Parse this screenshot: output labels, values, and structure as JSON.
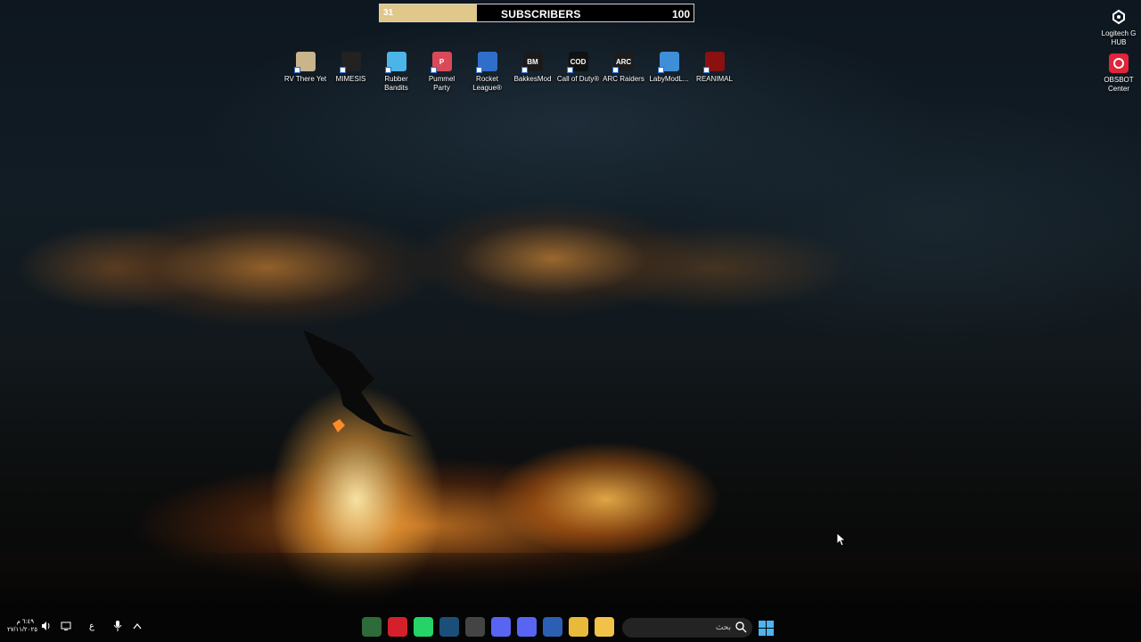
{
  "subscriber_widget": {
    "current": "31",
    "label": "SUBSCRIBERS",
    "goal": "100",
    "progress_fraction": 0.31,
    "fill_color": "#e0c78a"
  },
  "desktop_icons": [
    {
      "label": "RV There Yet",
      "icon": "rv-there-yet-icon",
      "color": "#c9b48c",
      "glyph": ""
    },
    {
      "label": "MIMESIS",
      "icon": "mimesis-icon",
      "color": "#222222",
      "glyph": ""
    },
    {
      "label": "Rubber Bandits",
      "icon": "rubber-bandits-icon",
      "color": "#4bb5e8",
      "glyph": ""
    },
    {
      "label": "Pummel Party",
      "icon": "pummel-party-icon",
      "color": "#d84a5a",
      "glyph": "P"
    },
    {
      "label": "Rocket League®",
      "icon": "rocket-league-icon",
      "color": "#2f6fc9",
      "glyph": ""
    },
    {
      "label": "BakkesMod",
      "icon": "bakkesmod-icon",
      "color": "#1a1a1a",
      "glyph": "BM"
    },
    {
      "label": "Call of Duty®",
      "icon": "call-of-duty-icon",
      "color": "#111111",
      "glyph": "COD"
    },
    {
      "label": "ARC Raiders",
      "icon": "arc-raiders-icon",
      "color": "#1c1c1c",
      "glyph": "ARC"
    },
    {
      "label": "LabyModL...",
      "icon": "labymod-icon",
      "color": "#3f8ed8",
      "glyph": ""
    },
    {
      "label": "REANIMAL",
      "icon": "reanimal-icon",
      "color": "#8b1010",
      "glyph": ""
    }
  ],
  "side_icons": [
    {
      "label": "Logitech G HUB",
      "icon": "logitech-g-hub-icon"
    },
    {
      "label": "OBSBOT Center",
      "icon": "obsbot-center-icon"
    }
  ],
  "taskbar": {
    "clock_time": "٦:٤٩ م",
    "clock_date": "٢٧/١١/٢٠٢٥",
    "language": "ع",
    "search_placeholder": "بحث",
    "apps": [
      {
        "name": "xbox-app-icon",
        "color": "#2d6b3a"
      },
      {
        "name": "adobe-app-icon",
        "color": "#d4202a"
      },
      {
        "name": "whatsapp-app-icon",
        "color": "#25d366"
      },
      {
        "name": "steam-app-icon",
        "color": "#1b4f7a"
      },
      {
        "name": "epic-games-app-icon",
        "color": "#444444"
      },
      {
        "name": "app-icon-purple",
        "color": "#5865f2"
      },
      {
        "name": "discord-app-icon",
        "color": "#5865f2"
      },
      {
        "name": "microsoft-store-app-icon",
        "color": "#2b5fb3"
      },
      {
        "name": "chrome-app-icon",
        "color": "#e9b93a"
      },
      {
        "name": "file-explorer-app-icon",
        "color": "#f2c14a"
      }
    ]
  }
}
